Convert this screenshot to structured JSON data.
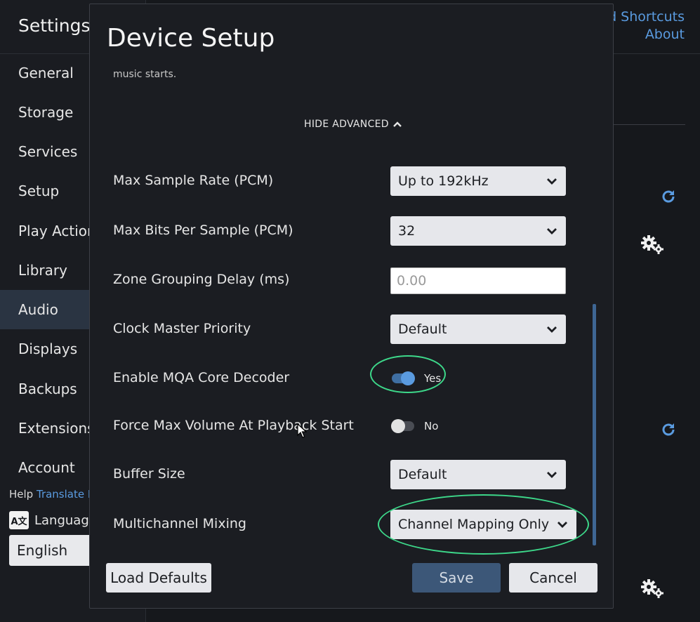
{
  "background": {
    "title": "Settings",
    "nav_items": [
      {
        "label": "General"
      },
      {
        "label": "Storage"
      },
      {
        "label": "Services"
      },
      {
        "label": "Setup"
      },
      {
        "label": "Play Action"
      },
      {
        "label": "Library"
      },
      {
        "label": "Audio",
        "active": true
      },
      {
        "label": "Displays"
      },
      {
        "label": "Backups"
      },
      {
        "label": "Extensions"
      },
      {
        "label": "Account"
      }
    ],
    "help_label": "Help",
    "translate_link": "Translate R",
    "language_label": "Languag",
    "language_icon_text": "A文",
    "language_value": "English",
    "top_links": [
      "rd Shortcuts",
      "About"
    ]
  },
  "dialog": {
    "title": "Device Setup",
    "description_tail": "music starts.",
    "hide_advanced": "HIDE ADVANCED",
    "rows": {
      "max_sample_rate": {
        "label": "Max Sample Rate (PCM)",
        "value": "Up to 192kHz"
      },
      "max_bits": {
        "label": "Max Bits Per Sample (PCM)",
        "value": "32"
      },
      "zone_grouping": {
        "label": "Zone Grouping Delay (ms)",
        "placeholder": "0.00"
      },
      "clock_master": {
        "label": "Clock Master Priority",
        "value": "Default"
      },
      "mqa_decoder": {
        "label": "Enable MQA Core Decoder",
        "state": "Yes"
      },
      "force_max_volume": {
        "label": "Force Max Volume At Playback Start",
        "state": "No"
      },
      "buffer_size": {
        "label": "Buffer Size",
        "value": "Default"
      },
      "multichannel_mixing": {
        "label": "Multichannel Mixing",
        "value": "Channel Mapping Only"
      }
    },
    "buttons": {
      "load_defaults": "Load Defaults",
      "save": "Save",
      "cancel": "Cancel"
    }
  },
  "colors": {
    "accent": "#5a9be0",
    "highlight": "#3dd88a",
    "primary_button": "#3c5778"
  }
}
